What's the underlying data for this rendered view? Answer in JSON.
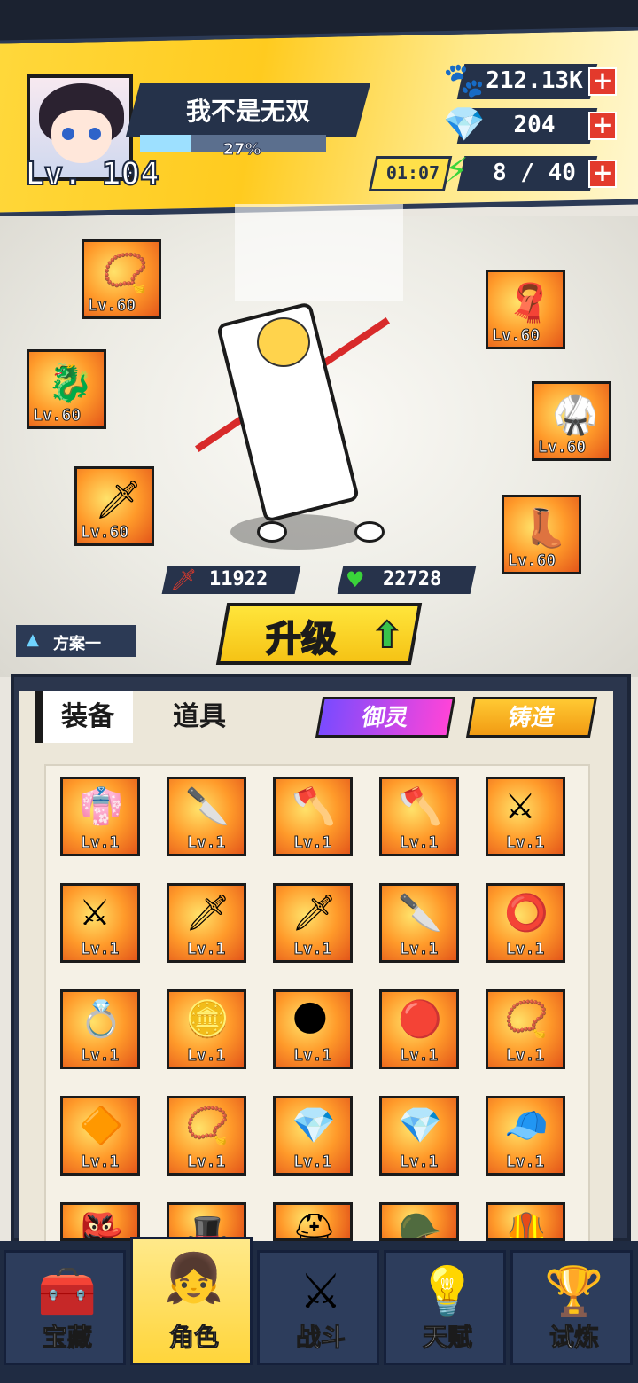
{
  "player": {
    "name": "我不是无双",
    "level": "Lv. 104",
    "exp_percent": "27%",
    "exp_fraction": 0.27
  },
  "resources": {
    "gold": "212.13K",
    "gems": "204",
    "energy": "8 / 40",
    "energy_timer": "01:07",
    "plus": "+"
  },
  "equipped": [
    {
      "icon": "necklace-icon",
      "glyph": "📿",
      "level": "Lv.60"
    },
    {
      "icon": "dragon-ring-icon",
      "glyph": "🐉",
      "level": "Lv.60"
    },
    {
      "icon": "blade-icon",
      "glyph": "🗡",
      "level": "Lv.60"
    },
    {
      "icon": "scarf-icon",
      "glyph": "🧣",
      "level": "Lv.60"
    },
    {
      "icon": "robe-icon",
      "glyph": "🥋",
      "level": "Lv.60"
    },
    {
      "icon": "boot-icon",
      "glyph": "👢",
      "level": "Lv.60"
    }
  ],
  "stats": {
    "attack": "11922",
    "hp": "22728"
  },
  "upgrade_button": "升级",
  "plan": "方案一",
  "tabs": {
    "equip": "装备",
    "items": "道具",
    "yuling": "御灵",
    "forge": "铸造"
  },
  "inventory": [
    {
      "icon": "uniform-icon",
      "glyph": "👘",
      "level": "Lv.1"
    },
    {
      "icon": "ice-blade-icon",
      "glyph": "🔪",
      "level": "Lv.1"
    },
    {
      "icon": "red-cleaver-icon",
      "glyph": "🪓",
      "level": "Lv.1"
    },
    {
      "icon": "red-cleaver-icon",
      "glyph": "🪓",
      "level": "Lv.1"
    },
    {
      "icon": "dark-blade-icon",
      "glyph": "⚔",
      "level": "Lv.1"
    },
    {
      "icon": "dark-blade-icon",
      "glyph": "⚔",
      "level": "Lv.1"
    },
    {
      "icon": "golden-sabre-icon",
      "glyph": "🗡",
      "level": "Lv.1"
    },
    {
      "icon": "golden-sabre-icon",
      "glyph": "🗡",
      "level": "Lv.1"
    },
    {
      "icon": "silver-sabre-icon",
      "glyph": "🔪",
      "level": "Lv.1"
    },
    {
      "icon": "red-ring-icon",
      "glyph": "⭕",
      "level": "Lv.1"
    },
    {
      "icon": "jade-ring-icon",
      "glyph": "💍",
      "level": "Lv.1"
    },
    {
      "icon": "gold-ring-icon",
      "glyph": "🪙",
      "level": "Lv.1"
    },
    {
      "icon": "dark-ring-icon",
      "glyph": "🌑",
      "level": "Lv.1"
    },
    {
      "icon": "seal-ring-icon",
      "glyph": "🔴",
      "level": "Lv.1"
    },
    {
      "icon": "bead-bracelet-icon",
      "glyph": "📿",
      "level": "Lv.1"
    },
    {
      "icon": "gold-pendant-icon",
      "glyph": "🔶",
      "level": "Lv.1"
    },
    {
      "icon": "pearl-necklace-icon",
      "glyph": "📿",
      "level": "Lv.1"
    },
    {
      "icon": "sapphire-pendant-icon",
      "glyph": "💎",
      "level": "Lv.1"
    },
    {
      "icon": "sapphire-pendant-icon",
      "glyph": "💎",
      "level": "Lv.1"
    },
    {
      "icon": "cap-icon",
      "glyph": "🧢",
      "level": "Lv.1"
    },
    {
      "icon": "mask-icon",
      "glyph": "👺",
      "level": ""
    },
    {
      "icon": "hat-icon",
      "glyph": "🎩",
      "level": ""
    },
    {
      "icon": "helmet-icon",
      "glyph": "⛑",
      "level": ""
    },
    {
      "icon": "pink-helmet-icon",
      "glyph": "🪖",
      "level": ""
    },
    {
      "icon": "vest-icon",
      "glyph": "🦺",
      "level": ""
    }
  ],
  "nav": [
    {
      "icon": "treasure-chest-icon",
      "glyph": "🧰",
      "label": "宝藏"
    },
    {
      "icon": "character-icon",
      "glyph": "👧",
      "label": "角色"
    },
    {
      "icon": "battle-swords-icon",
      "glyph": "⚔",
      "label": "战斗"
    },
    {
      "icon": "lightbulb-icon",
      "glyph": "💡",
      "label": "天赋"
    },
    {
      "icon": "trial-emblem-icon",
      "glyph": "🏆",
      "label": "试炼"
    }
  ],
  "colors": {
    "accent_yellow": "#ffd83b",
    "navy": "#25324a",
    "plus_red": "#e33a2c"
  }
}
